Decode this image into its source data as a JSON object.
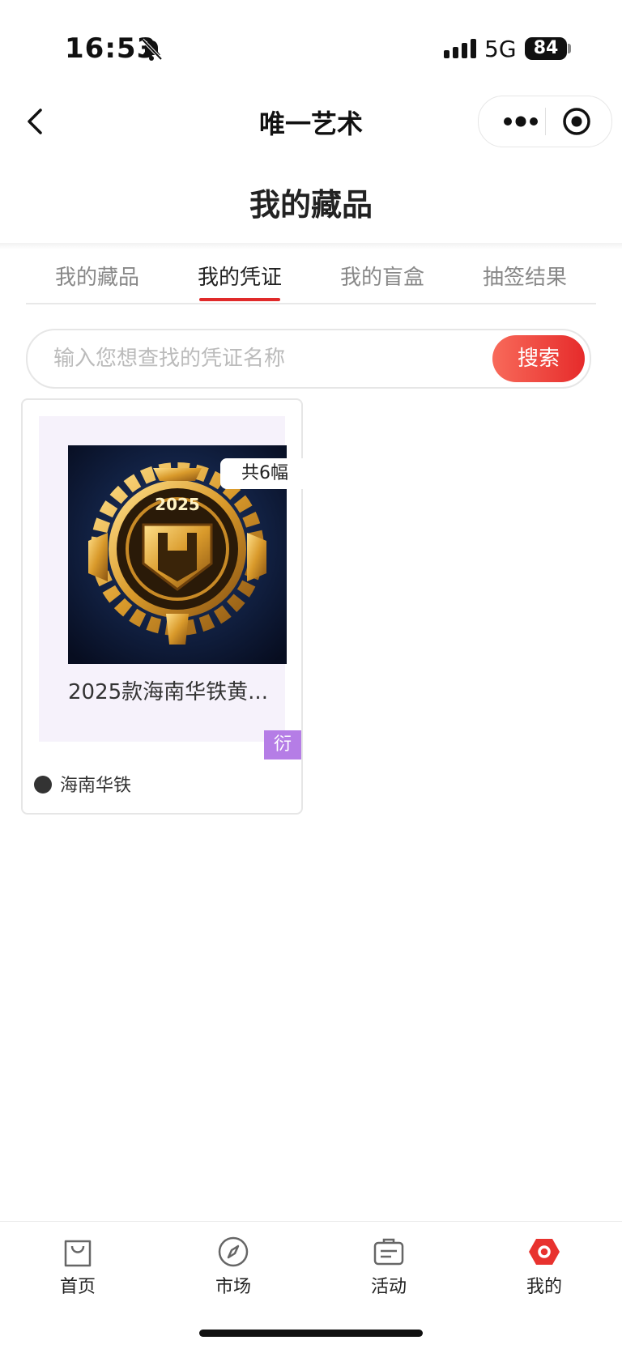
{
  "status_bar": {
    "time": "16:53",
    "network": "5G",
    "battery": "84"
  },
  "nav": {
    "title": "唯一艺术"
  },
  "page": {
    "title": "我的藏品"
  },
  "tabs": [
    {
      "label": "我的藏品",
      "active": false
    },
    {
      "label": "我的凭证",
      "active": true
    },
    {
      "label": "我的盲盒",
      "active": false
    },
    {
      "label": "抽签结果",
      "active": false
    }
  ],
  "search": {
    "placeholder": "输入您想查找的凭证名称",
    "button": "搜索"
  },
  "items": [
    {
      "name": "2025款海南华铁黄...",
      "count": "共6幅",
      "tag": "衍",
      "issuer": "海南华铁",
      "image_text": "2025"
    }
  ],
  "tabbar": [
    {
      "label": "首页",
      "icon": "shopping-bag-icon"
    },
    {
      "label": "市场",
      "icon": "compass-icon"
    },
    {
      "label": "活动",
      "icon": "briefcase-icon"
    },
    {
      "label": "我的",
      "icon": "profile-hexagon-icon",
      "active_color": "#e8322e"
    }
  ],
  "colors": {
    "accent": "#e62b2b",
    "tag": "#b57de6"
  }
}
